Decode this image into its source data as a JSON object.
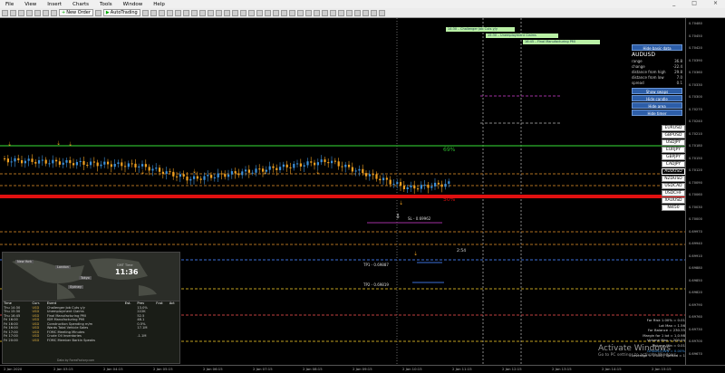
{
  "menu": {
    "items": [
      "File",
      "View",
      "Insert",
      "Charts",
      "Tools",
      "Window",
      "Help"
    ],
    "window_controls": [
      "_",
      "□",
      "×"
    ]
  },
  "toolbar": {
    "new_order": "New Order",
    "autotrading": "AutoTrading"
  },
  "news_bars": [
    {
      "text": "14:30 – Challenger Job Cuts y/y"
    },
    {
      "text": "15:30 – Unemployment Claims"
    },
    {
      "text": "16:45 – Final Manufacturing PMI"
    }
  ],
  "info": {
    "hide_basic": "Hide basic data",
    "symbol": "AUDUSD",
    "rows": [
      {
        "label": "range",
        "value": "36.8"
      },
      {
        "label": "change",
        "value": "-22.4"
      },
      {
        "label": "distance from high",
        "value": "29.8"
      },
      {
        "label": "distance from low",
        "value": "7.0"
      },
      {
        "label": "spread",
        "value": "0.1"
      }
    ],
    "buttons": [
      "Show swaps",
      "Hide candle",
      "Hide area",
      "Hide timer"
    ]
  },
  "pairs": [
    "EURUSD",
    "GBPUSD",
    "USDJPY",
    "EURJPY",
    "GBPJPY",
    "CADJPY",
    "AUDUSD",
    "NZDUSD",
    "USDCAD",
    "USDCHF",
    "XAUUSD",
    "NI450"
  ],
  "active_pair": "AUDUSD",
  "chart_labels": {
    "pct69": "69%",
    "pct50": "50%",
    "sl": "SL - 0.69962",
    "tp1": "TP1 - 0.69887",
    "tp2": "TP2 - 0.69819",
    "timer": "2:54"
  },
  "price_scale": [
    "0.70480",
    "0.70450",
    "0.70420",
    "0.70390",
    "0.70360",
    "0.70330",
    "0.70300",
    "0.70270",
    "0.70240",
    "0.70210",
    "0.70180",
    "0.70150",
    "0.70120",
    "0.70090",
    "0.70060",
    "0.70030",
    "0.70000",
    "0.69970",
    "0.69940",
    "0.69910",
    "0.69880",
    "0.69850",
    "0.69820",
    "0.69790",
    "0.69760",
    "0.69730",
    "0.69700",
    "0.69670"
  ],
  "time_axis": [
    "2 Jan 2020",
    "2 Jan 03:15",
    "2 Jan 04:15",
    "2 Jan 05:15",
    "2 Jan 06:15",
    "2 Jan 07:15",
    "2 Jan 08:15",
    "2 Jan 09:15",
    "2 Jan 10:15",
    "2 Jan 11:15",
    "2 Jan 12:15",
    "2 Jan 13:15",
    "2 Jan 14:15",
    "2 Jan 15:15"
  ],
  "world": {
    "cities": [
      "New York",
      "London",
      "Tokyo",
      "Sydney"
    ],
    "clock": "11:36",
    "clock_top": "GMT Time"
  },
  "calendar": {
    "headers": [
      "Time",
      "Curr.",
      "Event",
      "Est.",
      "Prev",
      "Fcst",
      "Act"
    ],
    "rows": [
      [
        "Thu 14:30",
        "USD",
        "Challenger Job Cuts y/y",
        "",
        "13.0%",
        "",
        ""
      ],
      [
        "Thu 15:30",
        "USD",
        "Unemployment Claims",
        "",
        "222K",
        "",
        ""
      ],
      [
        "Thu 16:45",
        "USD",
        "Final Manufacturing PMI",
        "",
        "52.5",
        "",
        ""
      ],
      [
        "Fri 16:00",
        "USD",
        "ISM Manufacturing PMI",
        "",
        "48.1",
        "",
        ""
      ],
      [
        "Fri 16:00",
        "USD",
        "Construction Spending m/m",
        "",
        "0.5%",
        "",
        ""
      ],
      [
        "Fri 16:00",
        "USD",
        "Wards Total Vehicle Sales",
        "",
        "17.1M",
        "",
        ""
      ],
      [
        "Fri 17:00",
        "USD",
        "FOMC Meeting Minutes",
        "",
        "",
        "",
        ""
      ],
      [
        "Fri 17:00",
        "USD",
        "Crude Oil Inventories",
        "",
        "-1.1M",
        "",
        ""
      ],
      [
        "Fri 20:00",
        "USD",
        "FOMC Member Barkin Speaks",
        "",
        "",
        "",
        ""
      ]
    ],
    "footer": "Data by ForexFactory.com"
  },
  "right_stats": [
    "For Risk 1.00% = 0.01",
    "Lot Max = 1.56",
    "For Balance = 230.35",
    "Margin for 1 lot = 1,0.98",
    "Volume Max = 200.00",
    "Volume Min = 0.01",
    "DRAWDOWN = 0.00%",
    "Leverage = 1:500 | Spread = 1"
  ],
  "watermark": {
    "title": "Activate Windows",
    "subtitle": "Go to PC settings to activate Windows."
  },
  "colors": {
    "bull": "#3b8fd9",
    "bear": "#f0a020",
    "green_line": "#2db52d",
    "red_line": "#e01010"
  }
}
